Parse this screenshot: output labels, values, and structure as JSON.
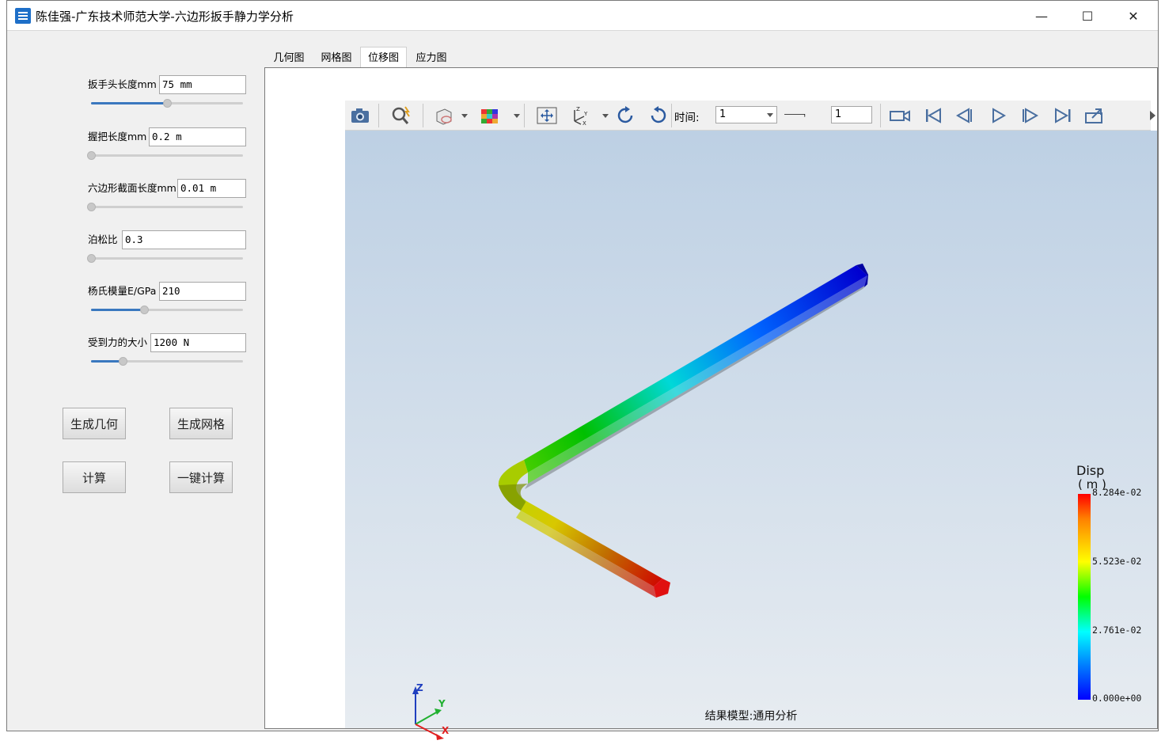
{
  "window": {
    "title": "陈佳强-广东技术师范大学-六边形扳手静力学分析",
    "minimize": "—",
    "maximize": "☐",
    "close": "✕"
  },
  "params": [
    {
      "label": "扳手头长度mm",
      "value": "75 mm",
      "slider_fraction": 0.5
    },
    {
      "label": "握把长度mm",
      "value": "0.2 m",
      "slider_fraction": 0.0
    },
    {
      "label": "六边形截面长度mm",
      "value": "0.01 m",
      "slider_fraction": 0.0
    },
    {
      "label": "泊松比",
      "value": "0.3",
      "slider_fraction": 0.0
    },
    {
      "label": "杨氏模量E/GPa",
      "value": "210",
      "slider_fraction": 0.35
    },
    {
      "label": "受到力的大小",
      "value": "1200 N",
      "slider_fraction": 0.21
    }
  ],
  "buttons": {
    "gen_geometry": "生成几何",
    "gen_mesh": "生成网格",
    "compute": "计算",
    "one_click": "一键计算"
  },
  "tabs": [
    {
      "label": "几何图",
      "active": false
    },
    {
      "label": "网格图",
      "active": false
    },
    {
      "label": "位移图",
      "active": true
    },
    {
      "label": "应力图",
      "active": false
    }
  ],
  "toolbar": {
    "time_label": "时间:",
    "time_value": "1",
    "step_value": "1"
  },
  "viewport": {
    "caption": "结果模型:通用分析",
    "axes": {
      "z": "Z",
      "y": "Y",
      "x": "X"
    }
  },
  "legend": {
    "title": "Disp",
    "unit": "( m )",
    "ticks": [
      "8.284e-02",
      "5.523e-02",
      "2.761e-02",
      "0.000e+00"
    ]
  }
}
